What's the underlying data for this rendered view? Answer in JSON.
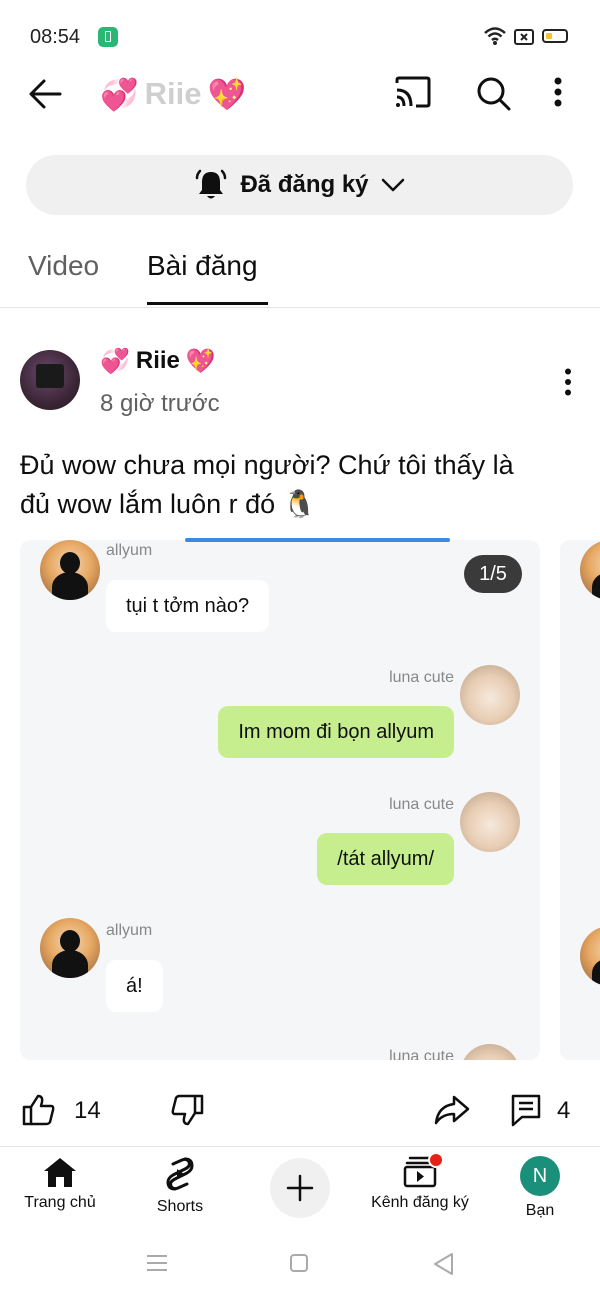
{
  "status_bar": {
    "time": "08:54"
  },
  "header": {
    "channel_name": "Riie",
    "emoji_left": "💞",
    "emoji_right": "💖"
  },
  "subscribe": {
    "label": "Đã đăng ký"
  },
  "tabs": [
    {
      "label": "Video",
      "active": false
    },
    {
      "label": "Bài đăng",
      "active": true
    }
  ],
  "post": {
    "author": "Riie",
    "author_emoji_left": "💞",
    "author_emoji_right": "💖",
    "time_ago": "8 giờ trước",
    "text_line1": "Đủ wow chưa mọi người? Chứ tôi thấy là",
    "text_line2": "đủ wow lắm luôn r đó 🐧",
    "image_counter": "1/5",
    "chat": {
      "m1_name": "allyum",
      "m1_text": "tụi t tởm nào?",
      "m2_name": "luna cute",
      "m2_text": "Im mom đi bọn allyum",
      "m3_name": "luna cute",
      "m3_text": "/tát allyum/",
      "m4_name": "allyum",
      "m4_text": "á!",
      "m5_name": "luna cute"
    },
    "likes": "14",
    "comments": "4"
  },
  "bottom_nav": [
    {
      "label": "Trang chủ",
      "icon": "home-icon"
    },
    {
      "label": "Shorts",
      "icon": "shorts-icon"
    },
    {
      "label": "",
      "icon": "plus-icon"
    },
    {
      "label": "Kênh đăng ký",
      "icon": "subscriptions-icon"
    },
    {
      "label": "Bạn",
      "icon": "avatar"
    }
  ],
  "you_initial": "N",
  "colors": {
    "accent_red": "#e62117",
    "chat_green": "#c6ee8f",
    "avatar_teal": "#1a8f7a"
  }
}
